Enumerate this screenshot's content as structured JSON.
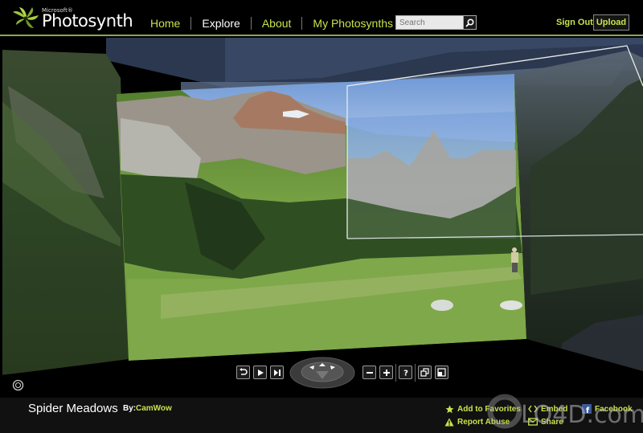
{
  "header": {
    "brand_prefix": "Microsoft®",
    "brand_name": "Photosynth",
    "nav": [
      {
        "label": "Home",
        "active": false
      },
      {
        "label": "Explore",
        "active": true
      },
      {
        "label": "About",
        "active": false
      },
      {
        "label": "My Photosynths",
        "active": false
      }
    ],
    "search": {
      "placeholder": "Search",
      "value": ""
    },
    "sign_out_label": "Sign Out",
    "upload_label": "Upload"
  },
  "viewer": {
    "scene_description": "Spider Meadows mountain valley panorama stitched from overlapping photos",
    "controls": {
      "reset_icon": "undo-icon",
      "play_icon": "play-icon",
      "next_icon": "skip-next-icon",
      "zoom_out_icon": "minus-icon",
      "zoom_in_icon": "plus-icon",
      "help_icon": "help-icon",
      "overlay_icon": "overlay-toggle-icon",
      "fullscreen_icon": "fullscreen-icon"
    }
  },
  "footer": {
    "title": "Spider Meadows",
    "by_label": "By:",
    "author": "CamWow",
    "links": [
      {
        "label": "Add to Favorites",
        "icon": "star-icon"
      },
      {
        "label": "Report Abuse",
        "icon": "warning-icon"
      },
      {
        "label": "Embed",
        "icon": "embed-icon"
      },
      {
        "label": "Share",
        "icon": "mail-icon"
      },
      {
        "label": "Facebook",
        "icon": "facebook-icon"
      }
    ]
  },
  "watermark": "LO4D.com",
  "colors": {
    "accent": "#c7e34d",
    "header_rule": "#8da456",
    "background": "#000000",
    "footer_bg": "#111111"
  }
}
